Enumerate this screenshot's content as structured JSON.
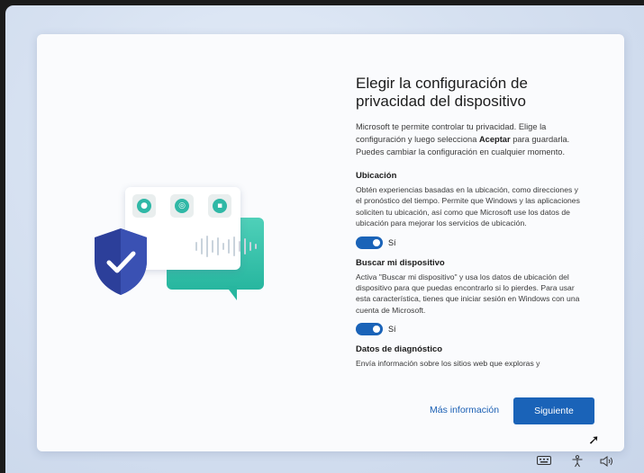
{
  "title": "Elegir la configuración de privacidad del dispositivo",
  "intro": {
    "part1": "Microsoft te permite controlar tu privacidad. Elige la configuración y luego selecciona",
    "bold": "Aceptar",
    "part2": "para guardarla. Puedes cambiar la configuración en cualquier momento."
  },
  "sections": [
    {
      "heading": "Ubicación",
      "body": "Obtén experiencias basadas en la ubicación, como direcciones y el pronóstico del tiempo. Permite que Windows y las aplicaciones soliciten tu ubicación, así como que Microsoft use los datos de ubicación para mejorar los servicios de ubicación.",
      "toggle_label": "Sí",
      "toggle_on": true
    },
    {
      "heading": "Buscar mi dispositivo",
      "body": "Activa \"Buscar mi dispositivo\" y usa los datos de ubicación del dispositivo para que puedas encontrarlo si lo pierdes. Para usar esta característica, tienes que iniciar sesión en Windows con una cuenta de Microsoft.",
      "toggle_label": "Sí",
      "toggle_on": true
    },
    {
      "heading": "Datos de diagnóstico",
      "body": "Envía información sobre los sitios web que exploras y"
    }
  ],
  "footer": {
    "more_info": "Más información",
    "next": "Siguiente"
  },
  "illustration_icons": [
    "location-pin-icon",
    "fingerprint-icon",
    "lock-icon",
    "shield-check-icon"
  ],
  "tray_icons": [
    "keyboard-icon",
    "accessibility-icon",
    "volume-icon"
  ],
  "colors": {
    "accent": "#1a63b8",
    "teal": "#2fb8a6",
    "shield": "#2c3f9a"
  }
}
